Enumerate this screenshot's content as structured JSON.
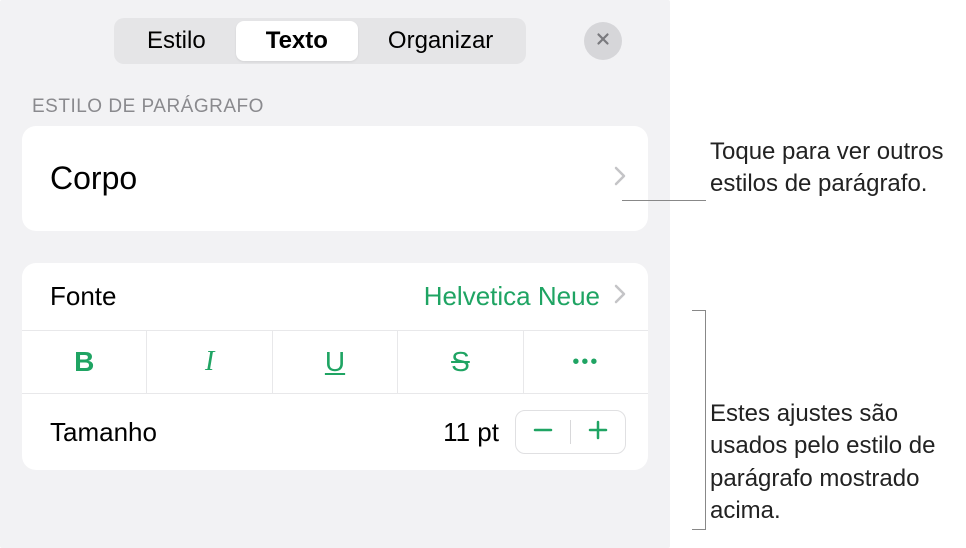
{
  "tabs": {
    "style": "Estilo",
    "text": "Texto",
    "arrange": "Organizar"
  },
  "sections": {
    "paragraphStyle": "ESTILO DE PARÁGRAFO"
  },
  "paragraphStyle": {
    "current": "Corpo"
  },
  "font": {
    "label": "Fonte",
    "value": "Helvetica Neue"
  },
  "styleButtons": {
    "bold": "B",
    "italic": "I",
    "underline": "U",
    "strike": "S",
    "more": "•••"
  },
  "size": {
    "label": "Tamanho",
    "value": "11 pt"
  },
  "callouts": {
    "c1": "Toque para ver outros estilos de parágrafo.",
    "c2": "Estes ajustes são usados pelo estilo de parágrafo mostrado acima."
  }
}
